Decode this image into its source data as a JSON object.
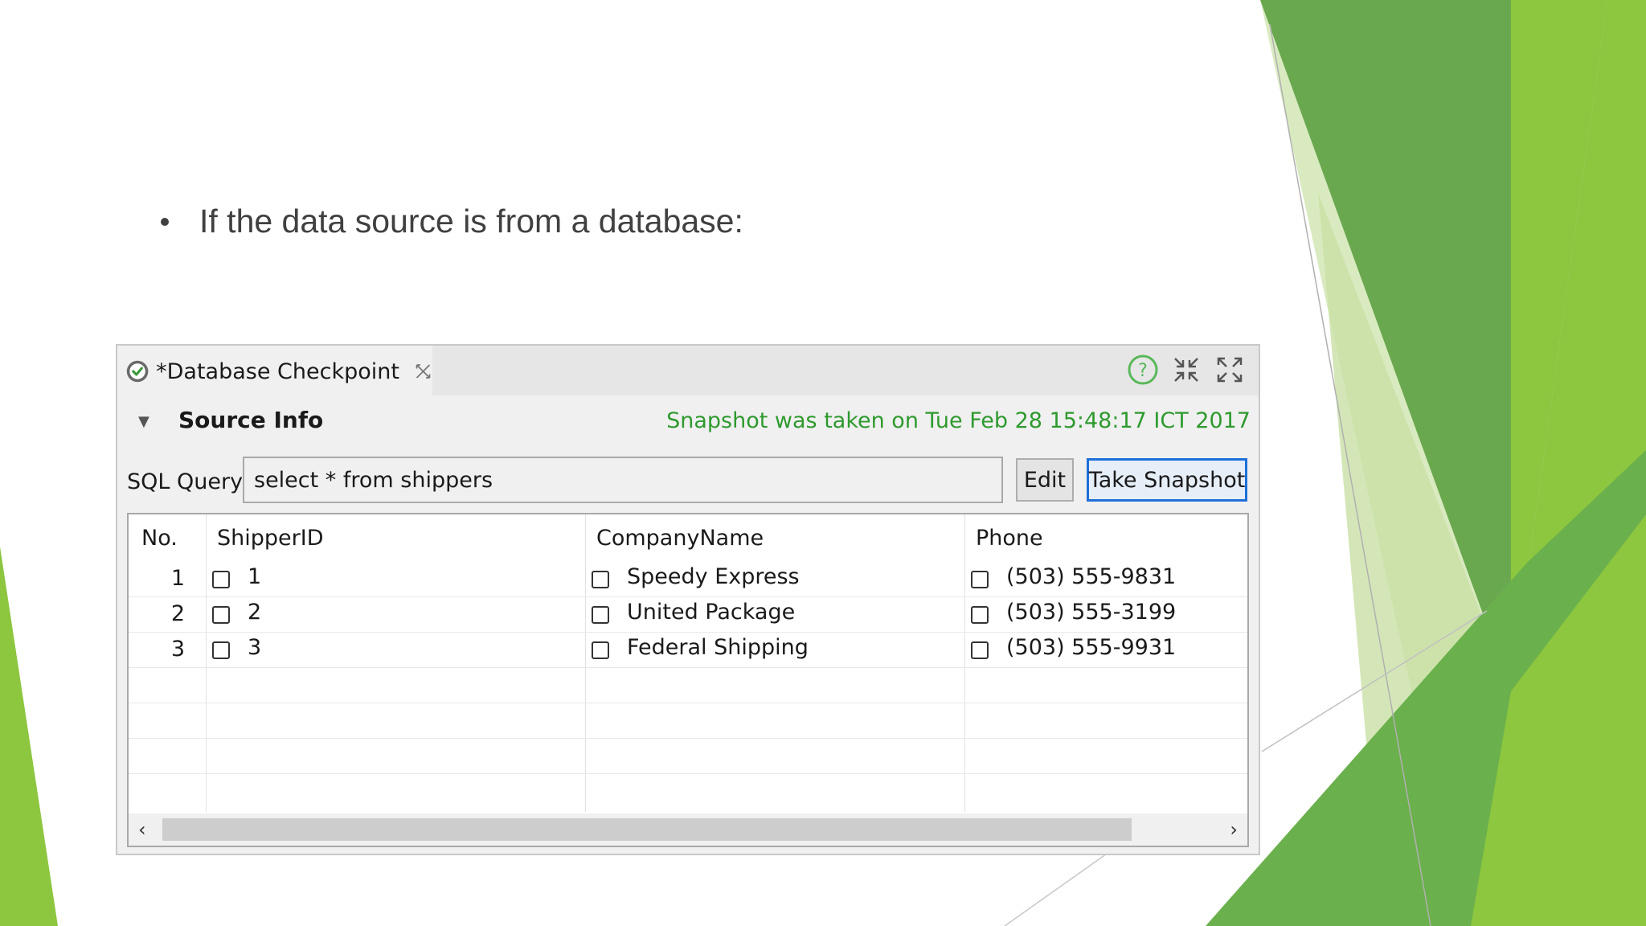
{
  "slide": {
    "bullet_text": "If the data source is from a database:",
    "accent_colors": [
      "#6aa84f",
      "#8dc63f",
      "#4e9a2a",
      "#c9e0a5"
    ]
  },
  "panel": {
    "tab_title": "*Database Checkpoint",
    "icons": {
      "tab": "checkpoint-icon",
      "close": "close-icon",
      "help": "help-icon",
      "minimize": "minimize-icon",
      "maximize": "maximize-icon"
    },
    "section_title": "Source Info",
    "snapshot_status": "Snapshot was taken on Tue Feb 28 15:48:17 ICT 2017",
    "sql_label": "SQL Query",
    "sql_value": "select * from shippers",
    "edit_label": "Edit",
    "take_snapshot_label": "Take Snapshot"
  },
  "table": {
    "columns": [
      "No.",
      "ShipperID",
      "CompanyName",
      "Phone"
    ],
    "rows": [
      {
        "no": "1",
        "shipper_id": "1",
        "company": "Speedy Express",
        "phone": "(503) 555-9831"
      },
      {
        "no": "2",
        "shipper_id": "2",
        "company": "United Package",
        "phone": "(503) 555-3199"
      },
      {
        "no": "3",
        "shipper_id": "3",
        "company": "Federal Shipping",
        "phone": "(503) 555-9931"
      }
    ]
  },
  "colors": {
    "status_green": "#2e9a2e",
    "snapshot_button_border": "#1e6fd9"
  }
}
